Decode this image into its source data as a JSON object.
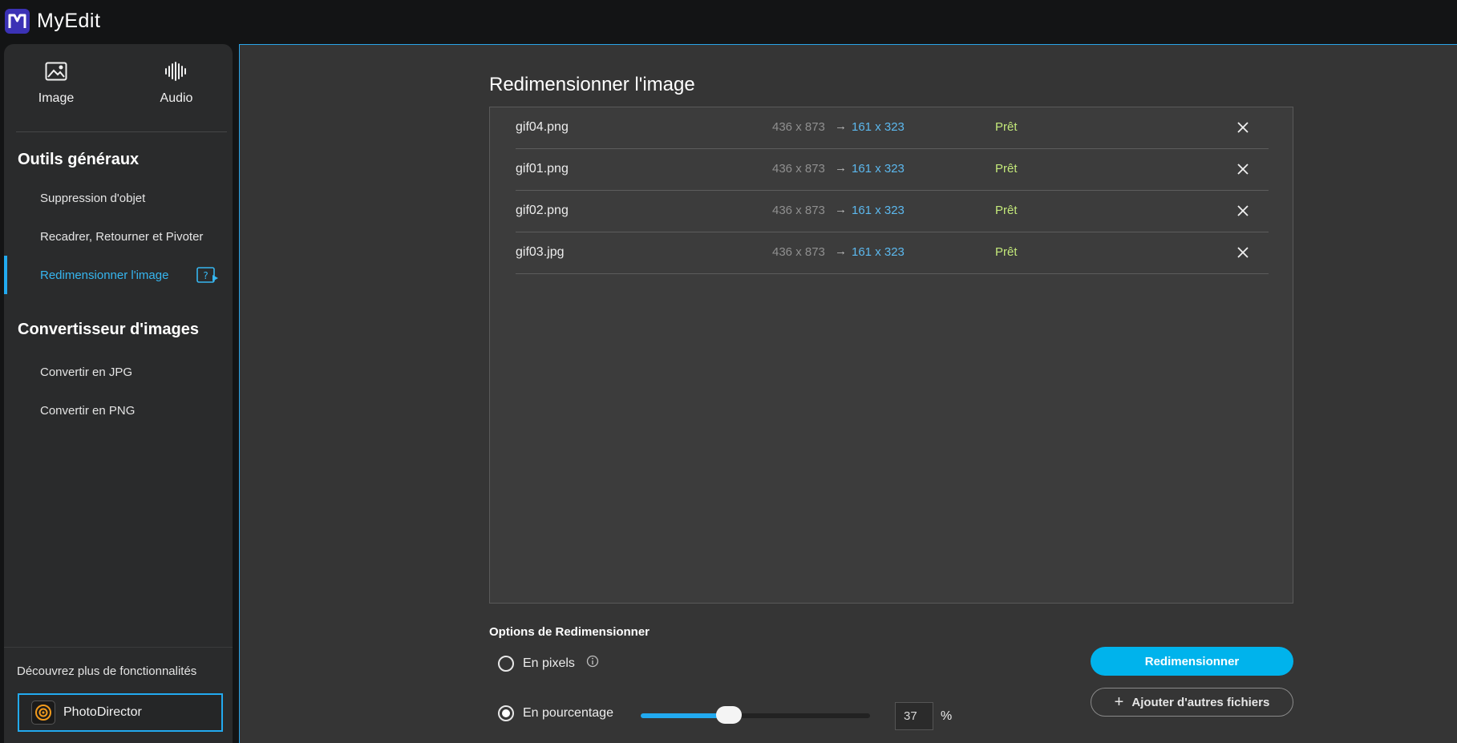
{
  "app": {
    "title": "MyEdit"
  },
  "colors": {
    "accent": "#22aaf0",
    "ready": "#c3e87a",
    "new_dim": "#5cb8ee",
    "logo": "#3b32b5"
  },
  "sidebar": {
    "modes": [
      {
        "label": "Image",
        "icon": "image-icon"
      },
      {
        "label": "Audio",
        "icon": "audio-waveform-icon"
      }
    ],
    "general_tools": {
      "title": "Outils généraux",
      "items": [
        {
          "label": "Suppression d'objet"
        },
        {
          "label": "Recadrer, Retourner et Pivoter"
        },
        {
          "label": "Redimensionner l'image",
          "active": true,
          "icon": "help-video-icon"
        }
      ]
    },
    "converter": {
      "title": "Convertisseur d'images",
      "items": [
        {
          "label": "Convertir en JPG"
        },
        {
          "label": "Convertir en PNG"
        }
      ]
    },
    "discover": "Découvrez plus de fonctionnalités",
    "promo_button": "PhotoDirector"
  },
  "main": {
    "title": "Redimensionner l'image",
    "arrow": "→",
    "files": [
      {
        "name": "gif04.png",
        "original": "436 x 873",
        "resized": "161 x 323",
        "status": "Prêt"
      },
      {
        "name": "gif01.png",
        "original": "436 x 873",
        "resized": "161 x 323",
        "status": "Prêt"
      },
      {
        "name": "gif02.png",
        "original": "436 x 873",
        "resized": "161 x 323",
        "status": "Prêt"
      },
      {
        "name": "gif03.jpg",
        "original": "436 x 873",
        "resized": "161 x 323",
        "status": "Prêt"
      }
    ],
    "options": {
      "title": "Options de Redimensionner",
      "pixels_label": "En pixels",
      "percent_label": "En pourcentage",
      "selected": "percent",
      "percent_value": "37",
      "percent_sign": "%",
      "slider_fraction": 0.37
    },
    "resize_button": "Redimensionner",
    "add_files_plus": "+",
    "add_files_button": "Ajouter d'autres fichiers"
  }
}
